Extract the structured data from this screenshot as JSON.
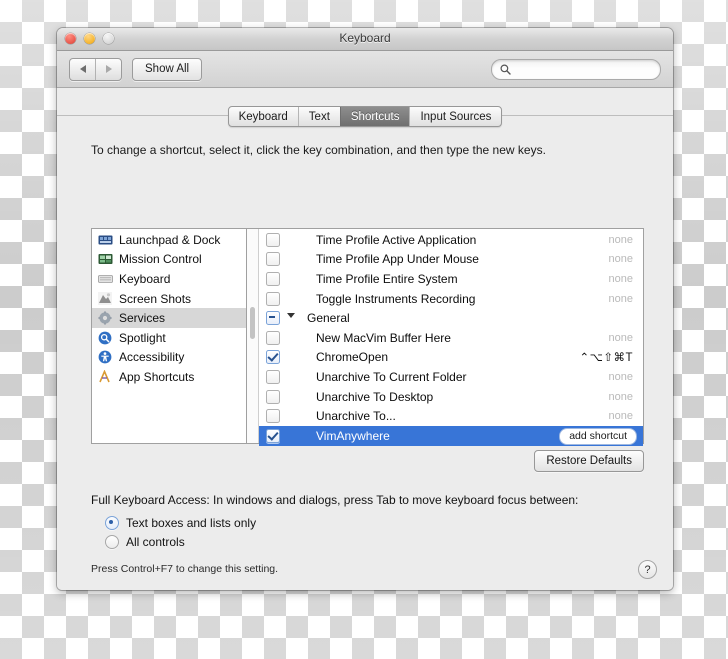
{
  "window": {
    "title": "Keyboard",
    "traffic_lights": [
      "close-button",
      "minimize-button",
      "zoom-button"
    ]
  },
  "toolbar": {
    "back_label": "◀",
    "forward_label": "▶",
    "show_all_label": "Show All",
    "search": {
      "value": "",
      "placeholder": ""
    }
  },
  "tabs": [
    {
      "label": "Keyboard",
      "selected": false
    },
    {
      "label": "Text",
      "selected": false
    },
    {
      "label": "Shortcuts",
      "selected": true
    },
    {
      "label": "Input Sources",
      "selected": false
    }
  ],
  "hint": "To change a shortcut, select it, click the key combination, and then type the new keys.",
  "categories": [
    {
      "label": "Launchpad & Dock",
      "icon": "launchpad-dock-icon",
      "selected": false
    },
    {
      "label": "Mission Control",
      "icon": "mission-control-icon",
      "selected": false
    },
    {
      "label": "Keyboard",
      "icon": "keyboard-icon",
      "selected": false
    },
    {
      "label": "Screen Shots",
      "icon": "screen-shots-icon",
      "selected": false
    },
    {
      "label": "Services",
      "icon": "services-gear-icon",
      "selected": true
    },
    {
      "label": "Spotlight",
      "icon": "spotlight-search-icon",
      "selected": false
    },
    {
      "label": "Accessibility",
      "icon": "accessibility-icon",
      "selected": false
    },
    {
      "label": "App Shortcuts",
      "icon": "app-shortcuts-icon",
      "selected": false
    }
  ],
  "shortcuts": [
    {
      "label": "Time Profile Active Application",
      "key": "none",
      "checked": false,
      "type": "item",
      "selected": false
    },
    {
      "label": "Time Profile App Under Mouse",
      "key": "none",
      "checked": false,
      "type": "item",
      "selected": false
    },
    {
      "label": "Time Profile Entire System",
      "key": "none",
      "checked": false,
      "type": "item",
      "selected": false
    },
    {
      "label": "Toggle Instruments Recording",
      "key": "none",
      "checked": false,
      "type": "item",
      "selected": false
    },
    {
      "label": "General",
      "key": "",
      "checked": "mixed",
      "type": "group",
      "selected": false
    },
    {
      "label": "New MacVim Buffer Here",
      "key": "none",
      "checked": false,
      "type": "item",
      "selected": false
    },
    {
      "label": "ChromeOpen",
      "key": "⌃⌥⇧⌘T",
      "checked": true,
      "type": "item",
      "selected": false
    },
    {
      "label": "Unarchive To Current Folder",
      "key": "none",
      "checked": false,
      "type": "item",
      "selected": false
    },
    {
      "label": "Unarchive To Desktop",
      "key": "none",
      "checked": false,
      "type": "item",
      "selected": false
    },
    {
      "label": "Unarchive To...",
      "key": "none",
      "checked": false,
      "type": "item",
      "selected": false
    },
    {
      "label": "VimAnywhere",
      "key": "",
      "checked": true,
      "type": "item",
      "selected": true,
      "button": "add shortcut"
    }
  ],
  "restore_defaults_label": "Restore Defaults",
  "full_keyboard_access": {
    "label": "Full Keyboard Access: In windows and dialogs, press Tab to move keyboard focus between:",
    "options": [
      {
        "label": "Text boxes and lists only",
        "selected": true
      },
      {
        "label": "All controls",
        "selected": false
      }
    ],
    "note": "Press Control+F7 to change this setting."
  },
  "help_label": "?",
  "colors": {
    "selection_blue": "#3875d7",
    "window_bg": "#ececec",
    "tab_selected": "#7f7f7f"
  }
}
